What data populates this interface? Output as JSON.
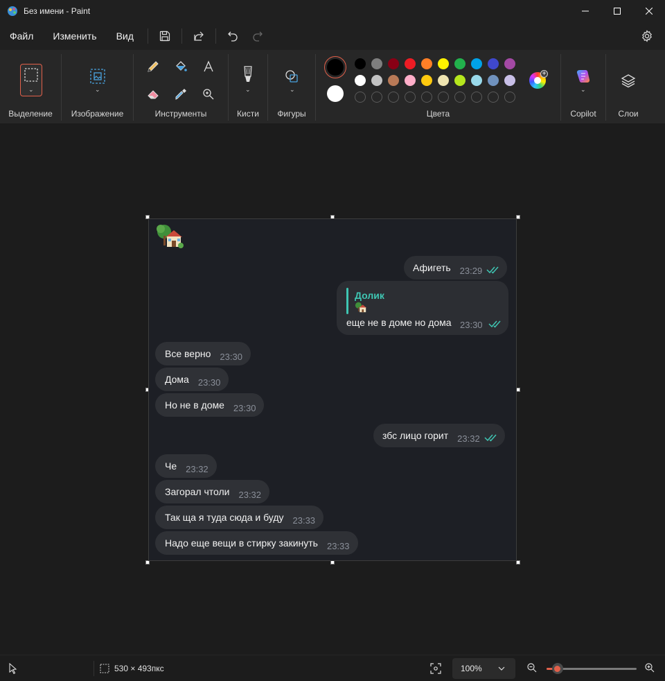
{
  "window": {
    "title": "Без имени - Paint"
  },
  "menu": {
    "file": "Файл",
    "edit": "Изменить",
    "view": "Вид"
  },
  "ribbon": {
    "groups": {
      "selection": "Выделение",
      "image": "Изображение",
      "tools": "Инструменты",
      "brushes": "Кисти",
      "shapes": "Фигуры",
      "colors": "Цвета",
      "copilot": "Copilot",
      "layers": "Слои"
    },
    "primary_color": "#000000",
    "secondary_color": "#ffffff",
    "palette_row1": [
      "#000000",
      "#7f7f7f",
      "#880015",
      "#ed1c24",
      "#ff7f27",
      "#fff200",
      "#22b14c",
      "#00a2e8",
      "#3f48cc",
      "#a349a4"
    ],
    "palette_row2": [
      "#ffffff",
      "#c3c3c3",
      "#b97a57",
      "#ffaec9",
      "#ffc90e",
      "#efe4b0",
      "#b5e61d",
      "#99d9ea",
      "#7092be",
      "#c8bfe7"
    ],
    "palette_row3_count": 10
  },
  "chat": {
    "messages": [
      {
        "direction": "out",
        "text": "Афигеть",
        "time": "23:29",
        "read": true
      },
      {
        "direction": "out",
        "reply_to": "Долик",
        "text": "еще не в доме но дома",
        "time": "23:30",
        "read": true
      },
      {
        "direction": "in",
        "text": "Все верно",
        "time": "23:30"
      },
      {
        "direction": "in",
        "text": "Дома",
        "time": "23:30"
      },
      {
        "direction": "in",
        "text": "Но не в доме",
        "time": "23:30"
      },
      {
        "direction": "out",
        "text": "збс лицо горит",
        "time": "23:32",
        "read": true
      },
      {
        "direction": "in",
        "text": "Че",
        "time": "23:32"
      },
      {
        "direction": "in",
        "text": "Загорал чтоли",
        "time": "23:32"
      },
      {
        "direction": "in",
        "text": "Так ща я туда сюда и буду",
        "time": "23:33"
      },
      {
        "direction": "in",
        "text": "Надо еще вещи в стирку закинуть",
        "time": "23:33"
      }
    ]
  },
  "status": {
    "canvas_size": "530 × 493пкс",
    "zoom": "100%",
    "zoom_level": 0.12
  },
  "colors": {
    "accent": "#e2604a",
    "chat_accent": "#3fc6b3"
  }
}
